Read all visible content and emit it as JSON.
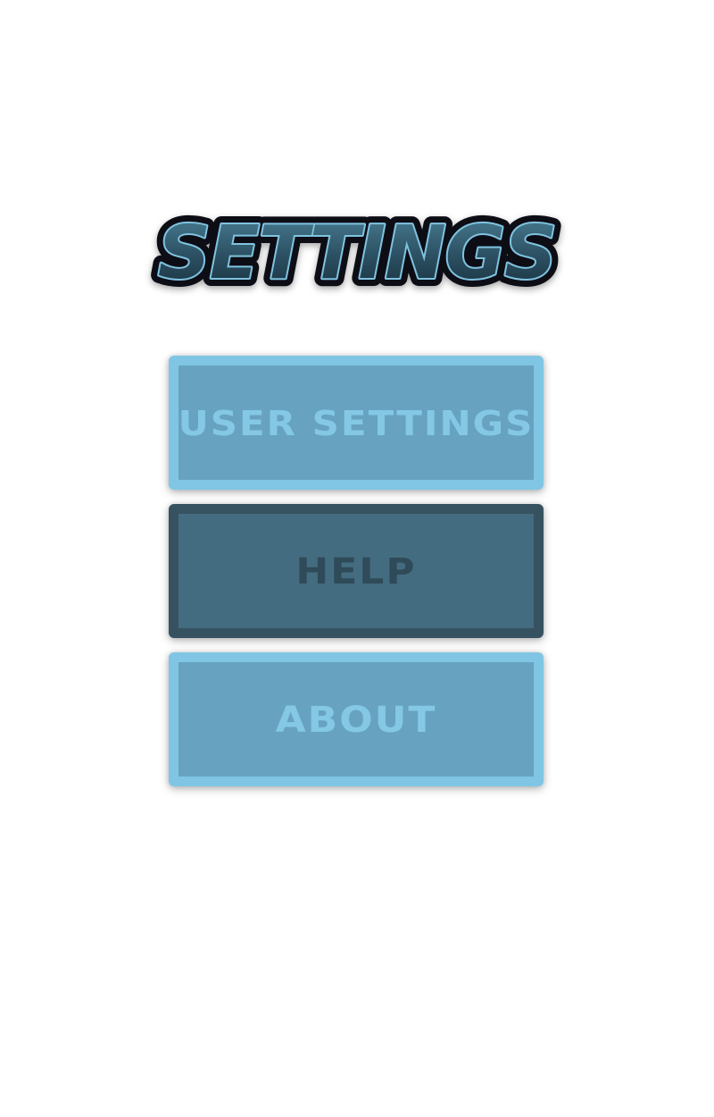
{
  "page": {
    "title": "SETTINGS"
  },
  "menu": {
    "items": [
      {
        "label": "USER SETTINGS",
        "state": "normal"
      },
      {
        "label": "HELP",
        "state": "selected"
      },
      {
        "label": "ABOUT",
        "state": "normal"
      }
    ]
  },
  "colors": {
    "background": "#ffffff",
    "button_fill": "#67a3c0",
    "button_border": "#80c6e4",
    "button_text": "#84c8e6",
    "selected_fill": "#446c80",
    "selected_border": "#365260",
    "selected_text": "#2f4a58",
    "title_outline": "#0b0f12",
    "title_fill_top": "#3e6d82",
    "title_fill_bottom": "#1c3442",
    "title_stroke_inner": "#7fc3e0"
  }
}
